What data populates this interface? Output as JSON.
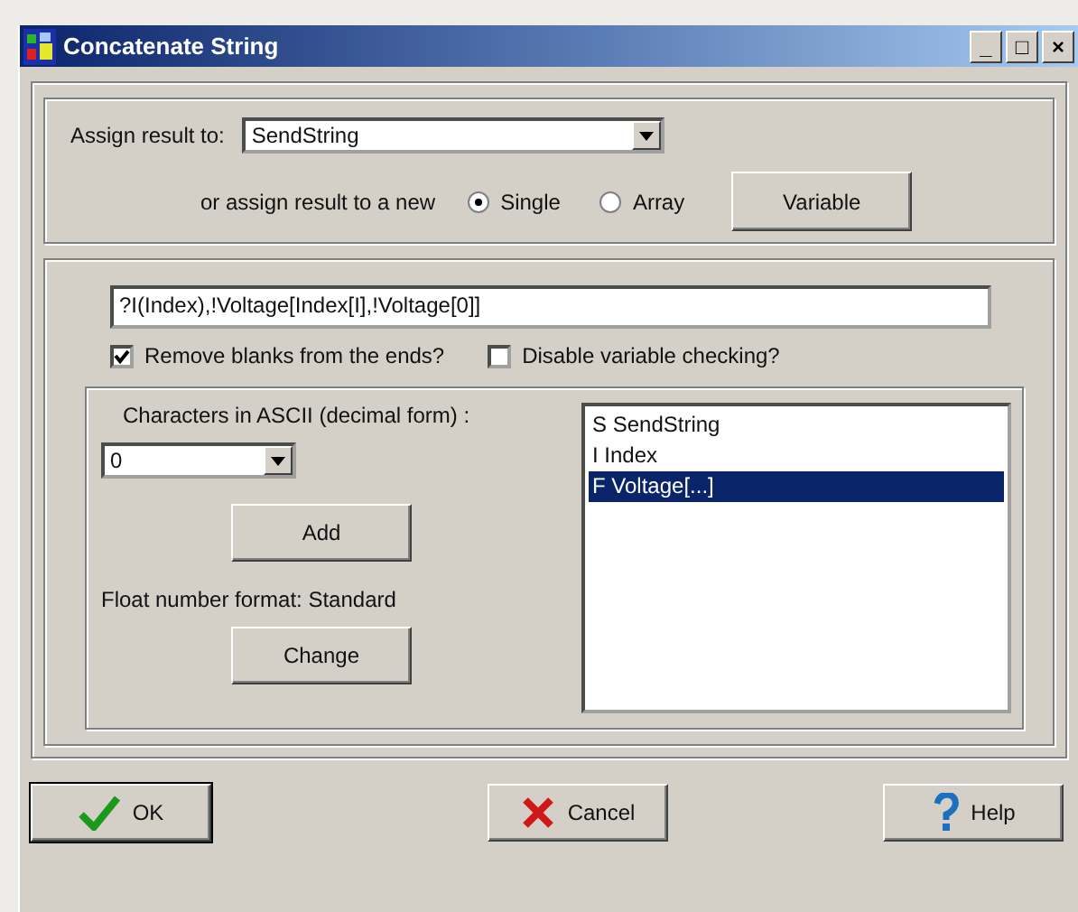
{
  "window": {
    "title": "Concatenate String",
    "controls": [
      "_",
      "□",
      "×"
    ]
  },
  "assign": {
    "label": "Assign result to:",
    "value": "SendString",
    "new_label": "or assign result to a new",
    "options": [
      {
        "label": "Single",
        "selected": true
      },
      {
        "label": "Array",
        "selected": false
      }
    ],
    "variable_button": "Variable"
  },
  "expression": {
    "value": "?I(Index),!Voltage[Index[I],!Voltage[0]]"
  },
  "checkboxes": [
    {
      "label": "Remove blanks from the ends?",
      "checked": true
    },
    {
      "label": "Disable variable checking?",
      "checked": false
    }
  ],
  "ascii": {
    "label": "Characters in ASCII (decimal form) :",
    "value": "0",
    "add_button": "Add",
    "format_label": "Float number format: Standard",
    "change_button": "Change"
  },
  "variables": [
    {
      "label": "S SendString",
      "selected": false
    },
    {
      "label": "I Index",
      "selected": false
    },
    {
      "label": "F Voltage[...]",
      "selected": true
    }
  ],
  "buttons": [
    {
      "kind": "ok",
      "label": "OK"
    },
    {
      "kind": "cancel",
      "label": "Cancel"
    },
    {
      "kind": "help",
      "label": "Help"
    }
  ]
}
